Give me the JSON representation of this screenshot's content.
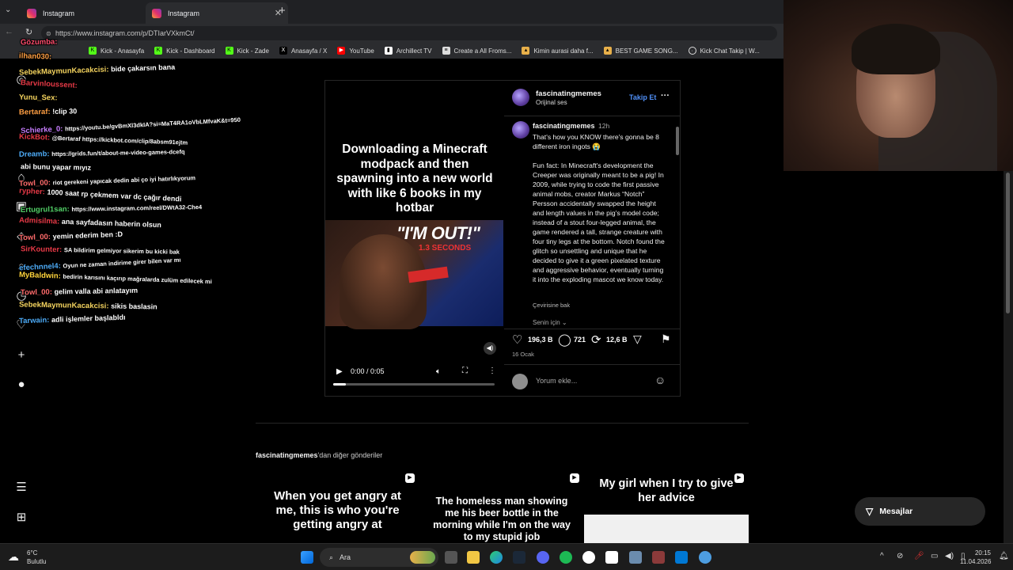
{
  "browser": {
    "tabs": [
      {
        "label": "Instagram",
        "active": false
      },
      {
        "label": "Instagram",
        "active": true
      }
    ],
    "new_tab": "+",
    "url": "https://www.instagram.com/p/DTIarVXkmCt/",
    "bookmarks": [
      "Kick - Anasayfa",
      "Kick - Dashboard",
      "Kick - Zade",
      "Anasayfa / X",
      "YouTube",
      "Archillect TV",
      "Create a All Froms...",
      "Kimin aurasi daha f...",
      "BEST GAME SONG...",
      "Kick Chat Takip | W..."
    ]
  },
  "chat": [
    {
      "user": "Gözumba:",
      "msg": "",
      "color": "#ff4d6d"
    },
    {
      "user": "ilhan030:",
      "msg": "",
      "color": "#ff9f43"
    },
    {
      "user": "SebekMaymunKacakcisi:",
      "msg": "bide çakarsın bana",
      "color": "#f4d35e"
    },
    {
      "user": "Barvinloussent:",
      "msg": "",
      "color": "#e63946"
    },
    {
      "user": "Yunu_Sex:",
      "msg": "",
      "color": "#f4d35e"
    },
    {
      "user": "Bertaraf:",
      "msg": "!clip 30",
      "color": "#ff9f43"
    },
    {
      "user": "Schierke_0:",
      "msg": "https://youtu.be/gvBmXl3dkIA?si=MaT4RA1oVbLMfvaK&t=950",
      "color": "#c77dff"
    },
    {
      "user": "KickBot:",
      "msg": "@Bertaraf https://kickbot.com/clip/8absm91ejtm",
      "color": "#e63946"
    },
    {
      "user": "Dreamb:",
      "msg": "https://grids.fun/t/about-me-video-games-dcefq",
      "color": "#4dabf7"
    },
    {
      "user": "",
      "msg": "abi bunu yapar mıyız",
      "color": "#ffffff"
    },
    {
      "user": "Towl_00:",
      "msg": "riot gerekeni yapıcak dedin abi ço iyi hatırlıkyorum",
      "color": "#ff6b6b"
    },
    {
      "user": "rypher:",
      "msg": "1000 saat rp çekmem var dc çağır dendi",
      "color": "#e63946"
    },
    {
      "user": "Ertugrul1san:",
      "msg": "https://www.instagram.com/reel/DWtA32-Che4",
      "color": "#51cf66"
    },
    {
      "user": "Admisilma:",
      "msg": "ana sayfadasın haberin olsun",
      "color": "#e63946"
    },
    {
      "user": "Towl_00:",
      "msg": "yemin ederim ben :D",
      "color": "#ff6b6b"
    },
    {
      "user": "SirKounter:",
      "msg": "SA bildirim gelmiyor sikerim bu kicki bak",
      "color": "#e63946"
    },
    {
      "user": "efechnnel4:",
      "msg": "Oyun ne zaman indirime girer bilen var mı",
      "color": "#4dabf7"
    },
    {
      "user": "MyBaldwin:",
      "msg": "bedirin karısını kaçırıp mağralarda zulüm edilecek mi",
      "color": "#ffd43b"
    },
    {
      "user": "Towl_00:",
      "msg": "gelim valla abi anlatayım",
      "color": "#ff6b6b"
    },
    {
      "user": "SebekMaymunKacakcisi:",
      "msg": "sikis baslasin",
      "color": "#f4d35e"
    },
    {
      "user": "Tarwain:",
      "msg": "adli işlemler başlabldı",
      "color": "#4dabf7"
    }
  ],
  "post": {
    "video_caption": "Downloading a Minecraft modpack and then spawning into a new world with like 6 books in my hotbar",
    "meme_text": "\"I'M OUT!\"",
    "meme_sub": "1.3 SECONDS",
    "time_display": "0:00 / 0:05",
    "progress": 0.08,
    "author": "fascinatingmemes",
    "audio": "Orijinal ses",
    "follow": "Takip Et",
    "more": "···",
    "comment_author": "fascinatingmemes",
    "comment_age": "12h",
    "caption": "That's how you KNOW there's gonna be 8 different iron ingots 😭\n\nFun fact: In Minecraft's development the Creeper was originally meant to be a pig! In 2009, while trying to code the first passive animal mobs, creator Markus “Notch” Persson accidentally swapped the height and length values in the pig’s model code; instead of a stout four-legged animal, the game rendered a tall, strange creature with four tiny legs at the bottom. Notch found the glitch so unsettling and unique that he decided to give it a green pixelated texture and aggressive behavior, eventually turning it into the exploding mascot we know today.",
    "see_translation": "Çevirisine bak",
    "for_you": "Senin için",
    "likes": "196,3 B",
    "comments": "721",
    "reposts": "12,6 B",
    "date": "16 Ocak",
    "comment_placeholder": "Yorum ekle..."
  },
  "more_posts": {
    "header_user": "fascinatingmemes",
    "header_suffix": "'dan diğer gönderiler",
    "items": [
      "When you get angry at me, this is who you're getting angry at",
      "The homeless man showing me his beer bottle in the morning while I'm on the way to my stupid job",
      "My girl when I try to give her advice"
    ]
  },
  "messages_label": "Mesajlar",
  "taskbar": {
    "weather_temp": "6°C",
    "weather_desc": "Bulutlu",
    "search": "Ara",
    "time": "20:15",
    "date": "11.04.2026"
  }
}
